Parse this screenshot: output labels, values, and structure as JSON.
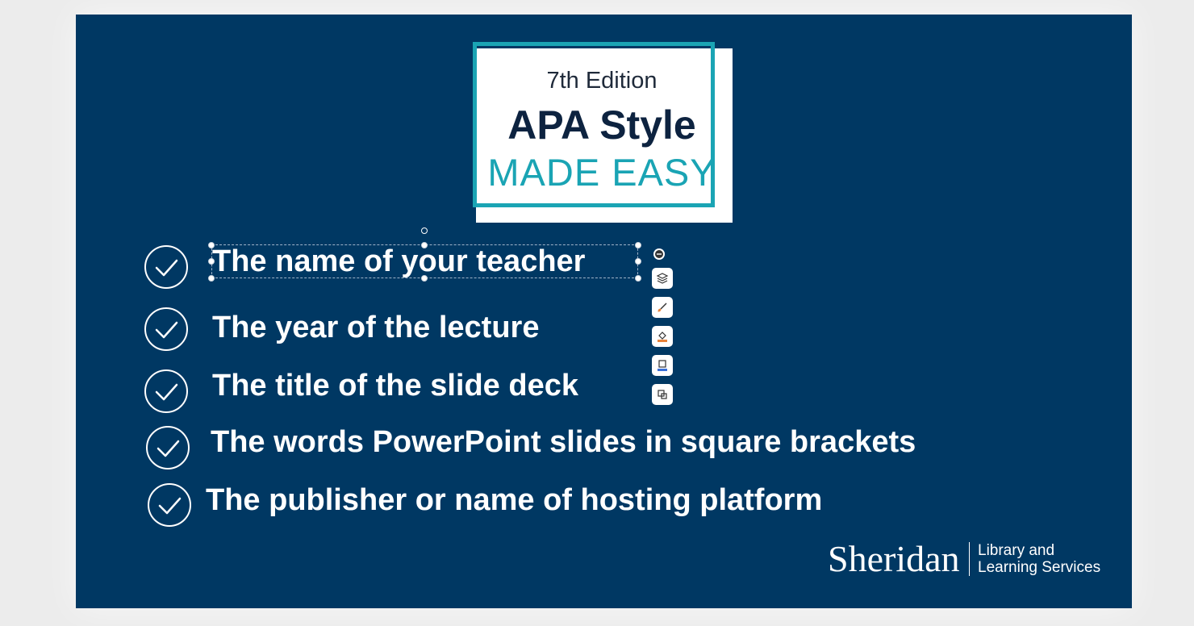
{
  "slide": {
    "logo": {
      "edition": "7th Edition",
      "title": "APA Style",
      "subtitle": "MADE EASY"
    },
    "items": [
      {
        "text": "The name of your teacher",
        "selected": true
      },
      {
        "text": "The year of the lecture"
      },
      {
        "text": "The title of the slide deck"
      },
      {
        "text": "The words PowerPoint slides in square brackets"
      },
      {
        "text": "The publisher or name of hosting platform"
      }
    ],
    "footer": {
      "brand": "Sheridan",
      "line1": "Library and",
      "line2": "Learning Services"
    }
  },
  "floating_toolbar": {
    "items": [
      "collapse-icon",
      "layers-icon",
      "brush-icon",
      "fill-icon",
      "outline-icon",
      "crop-icon"
    ]
  },
  "colors": {
    "slide_background": "#003863",
    "logo_accent": "#1aa4b4",
    "logo_title": "#0d2340",
    "text": "#ffffff"
  }
}
